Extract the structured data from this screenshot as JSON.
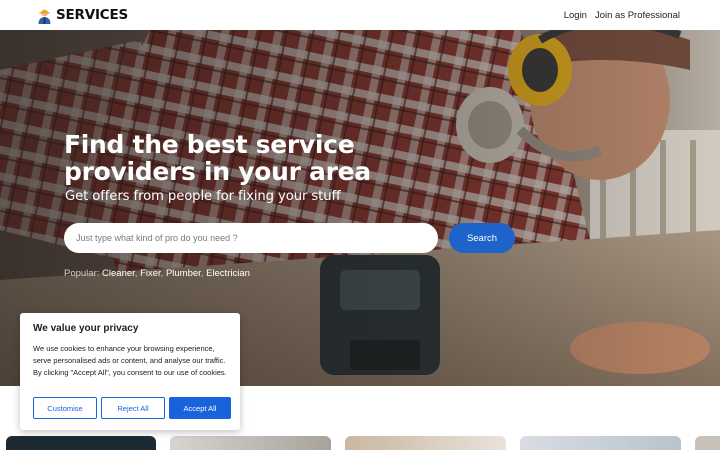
{
  "header": {
    "logo_text": "SERVICES",
    "logo_icon": "worker-icon",
    "nav": {
      "login_label": "Login",
      "join_label": "Join as Professional"
    }
  },
  "hero": {
    "title_line1": "Find the best service",
    "title_line2": "providers in your area",
    "subtitle": "Get offers from people for fixing your stuff",
    "search": {
      "placeholder": "Just type what kind of pro do you need ?",
      "button_label": "Search"
    },
    "popular": {
      "label": "Popular:",
      "items": [
        "Cleaner",
        "Fixer",
        "Plumber",
        "Electrician"
      ]
    }
  },
  "cookie_banner": {
    "title": "We value your privacy",
    "text": "We use cookies to enhance your browsing experience, serve personalised ads or content, and analyse our traffic. By clicking \"Accept All\", you consent to our use of cookies.",
    "customise_label": "Customise",
    "reject_label": "Reject All",
    "accept_label": "Accept All"
  },
  "colors": {
    "accent": "#1e63c9",
    "cookie_accent": "#1863dc"
  }
}
